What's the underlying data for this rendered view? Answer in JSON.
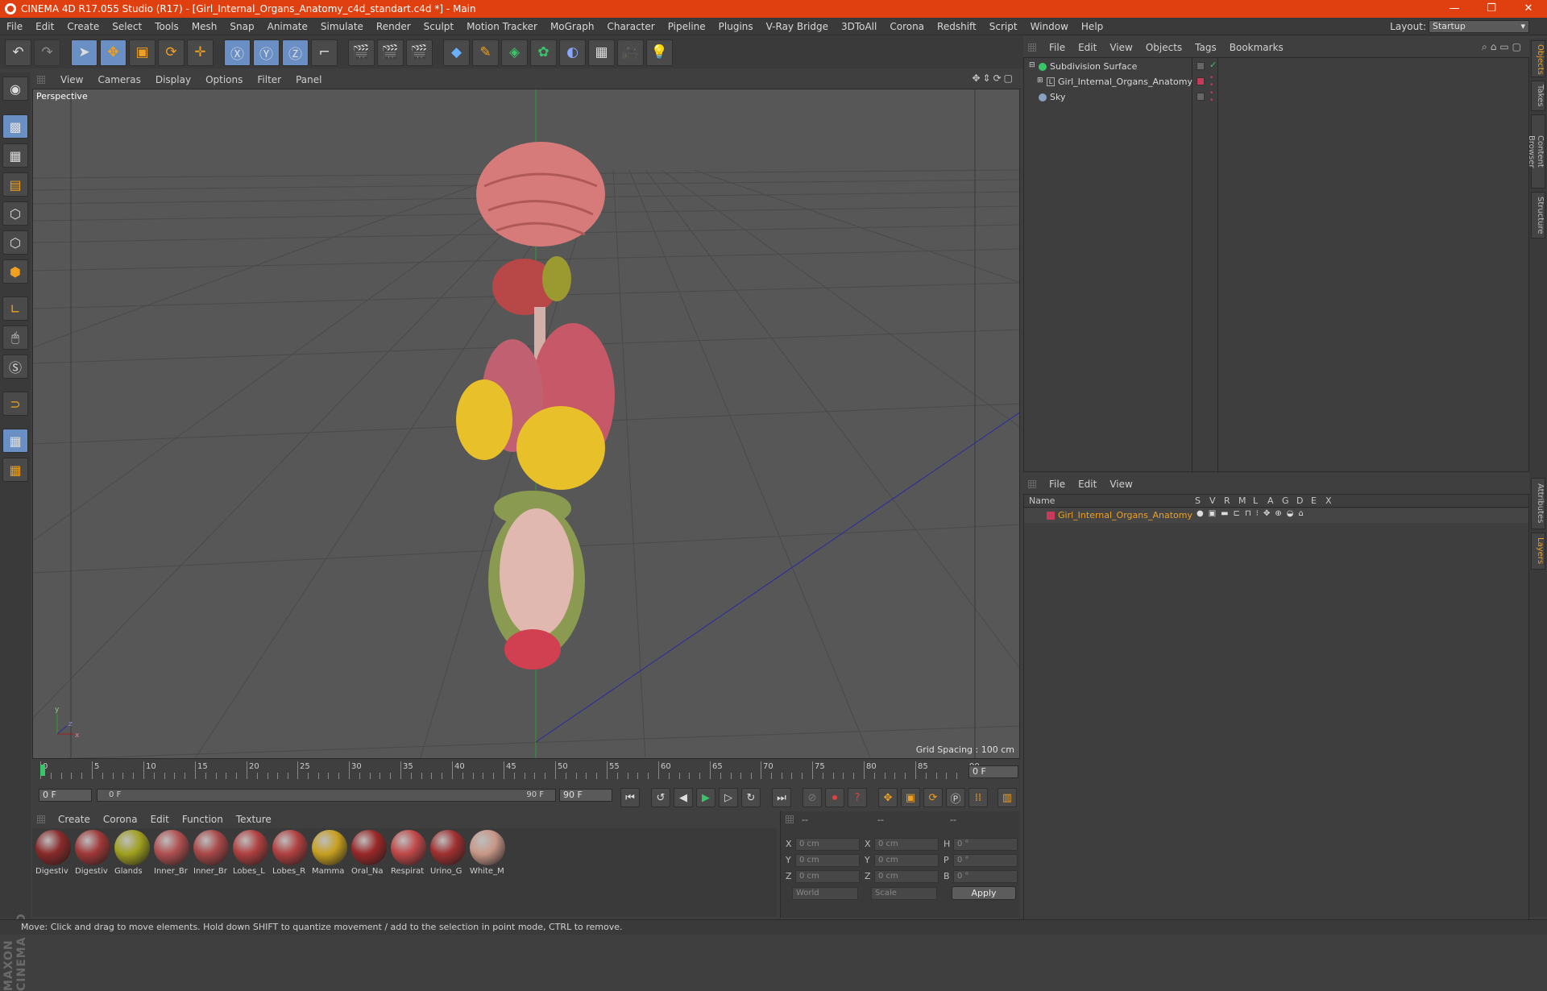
{
  "window": {
    "title": "CINEMA 4D R17.055 Studio (R17) - [Girl_Internal_Organs_Anatomy_c4d_standart.c4d *] - Main",
    "minimize": "—",
    "restore": "❐",
    "close": "✕"
  },
  "menu": [
    "File",
    "Edit",
    "Create",
    "Select",
    "Tools",
    "Mesh",
    "Snap",
    "Animate",
    "Simulate",
    "Render",
    "Sculpt",
    "Motion Tracker",
    "MoGraph",
    "Character",
    "Pipeline",
    "Plugins",
    "V-Ray Bridge",
    "3DToAll",
    "Corona",
    "Redshift",
    "Script",
    "Window",
    "Help"
  ],
  "layout": {
    "label": "Layout:",
    "value": "Startup"
  },
  "viewport": {
    "menu": [
      "View",
      "Cameras",
      "Display",
      "Options",
      "Filter",
      "Panel"
    ],
    "label": "Perspective",
    "grid_spacing": "Grid Spacing : 100 cm",
    "axis_x": "x",
    "axis_y": "y",
    "axis_z": "z"
  },
  "timeline": {
    "ticks": [
      "0",
      "5",
      "10",
      "15",
      "20",
      "25",
      "30",
      "35",
      "40",
      "45",
      "50",
      "55",
      "60",
      "65",
      "70",
      "75",
      "80",
      "85",
      "90"
    ],
    "current_frame": "0 F",
    "start_frame": "0 F",
    "range_start": "0 F",
    "range_end": "90 F",
    "end_frame": "90 F"
  },
  "materials": {
    "menu": [
      "Create",
      "Corona",
      "Edit",
      "Function",
      "Texture"
    ],
    "items": [
      {
        "name": "Digestiv",
        "color": "#8a2a2a"
      },
      {
        "name": "Digestiv",
        "color": "#a03838"
      },
      {
        "name": "Glands",
        "color": "#a0a020"
      },
      {
        "name": "Inner_Br",
        "color": "#b05050"
      },
      {
        "name": "Inner_Br",
        "color": "#a84848"
      },
      {
        "name": "Lobes_L",
        "color": "#b04040"
      },
      {
        "name": "Lobes_R",
        "color": "#b04040"
      },
      {
        "name": "Mamma",
        "color": "#c8a020"
      },
      {
        "name": "Oral_Na",
        "color": "#9a2828"
      },
      {
        "name": "Respirat",
        "color": "#c04848"
      },
      {
        "name": "Urino_G",
        "color": "#a03030"
      },
      {
        "name": "White_M",
        "color": "#c89888"
      }
    ]
  },
  "coords": {
    "head": [
      "--",
      "--",
      "--"
    ],
    "rows": [
      {
        "l1": "X",
        "v1": "0 cm",
        "l2": "X",
        "v2": "0 cm",
        "l3": "H",
        "v3": "0 °"
      },
      {
        "l1": "Y",
        "v1": "0 cm",
        "l2": "Y",
        "v2": "0 cm",
        "l3": "P",
        "v3": "0 °"
      },
      {
        "l1": "Z",
        "v1": "0 cm",
        "l2": "Z",
        "v2": "0 cm",
        "l3": "B",
        "v3": "0 °"
      }
    ],
    "space": "World",
    "mode": "Scale",
    "apply": "Apply"
  },
  "objects_panel": {
    "menu": [
      "File",
      "Edit",
      "View",
      "Objects",
      "Tags",
      "Bookmarks"
    ],
    "items": [
      {
        "name": "Subdivision Surface",
        "tag_color": "#39c46a"
      },
      {
        "name": "Girl_Internal_Organs_Anatomy",
        "tag_color": "#c83a5a"
      },
      {
        "name": "Sky",
        "tag_color": "#8aa0c0"
      }
    ]
  },
  "layers_panel": {
    "menu": [
      "File",
      "Edit",
      "View"
    ],
    "columns": [
      "Name",
      "S",
      "V",
      "R",
      "M",
      "L",
      "A",
      "G",
      "D",
      "E",
      "X"
    ],
    "items": [
      {
        "name": "Girl_Internal_Organs_Anatomy",
        "color": "#c83a5a"
      }
    ]
  },
  "right_tabs": [
    "Objects",
    "Takes",
    "Content Browser",
    "Structure",
    "Attributes",
    "Layers"
  ],
  "status": "Move: Click and drag to move elements. Hold down SHIFT to quantize movement / add to the selection in point mode, CTRL to remove.",
  "brand": "MAXON CINEMA 4D",
  "colors": {
    "titlebar": "#e0400f",
    "accent": "#f0a020",
    "active_tool": "#6a8fc4"
  }
}
